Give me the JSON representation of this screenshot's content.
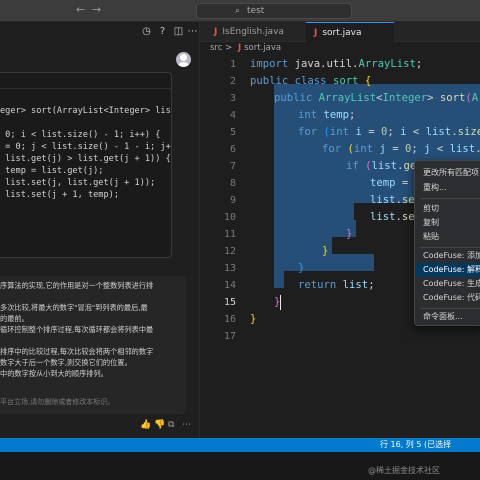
{
  "titlebar": {
    "back_icon": "arrow-left-icon",
    "forward_icon": "arrow-right-icon",
    "search_text": "test"
  },
  "chat": {
    "toolbar_icons": [
      "history-icon",
      "help-icon",
      "split-icon",
      "more-icon"
    ],
    "code_lines": [
      "eger> sort(ArrayList<Integer> list)",
      "",
      " 0; i < list.size() - 1; i++) {",
      " = 0; j < list.size() - 1 - i; j++",
      " list.get(j) > list.get(j + 1)) {",
      " temp = list.get(j);",
      " list.set(j, list.get(j + 1));",
      " list.set(j + 1, temp);"
    ],
    "reply_lines": [
      "序算法的实现,它的作用是对一个整数列表进行排",
      "",
      "多次比较,将最大的数字\"冒泡\"到列表的最后,最",
      "的最前。",
      "循环控制整个排序过程,每次循环都会将列表中最",
      "",
      "排序中的比较过程,每次比较会将两个相邻的数字",
      "数字大于后一个数字,则交换它们的位置。",
      "中的数字按从小到大的顺序排列。"
    ],
    "reply_note": "平台立场,请勿删除或者修改本标识。",
    "actions": [
      "thumb-up-icon",
      "thumb-down-icon",
      "copy-icon",
      "more-icon"
    ]
  },
  "tabs": [
    {
      "label": "IsEnglish.java",
      "icon": "java-file-icon",
      "active": false
    },
    {
      "label": "sort.java",
      "icon": "java-file-icon",
      "active": true
    }
  ],
  "breadcrumb": {
    "folder": "src",
    "sep": ">",
    "file": "sort.java"
  },
  "editor": {
    "current_line": 15,
    "line_numbers": [
      "1",
      "2",
      "3",
      "4",
      "5",
      "6",
      "7",
      "8",
      "9",
      "10",
      "11",
      "12",
      "13",
      "14",
      "15",
      "16",
      "17"
    ]
  },
  "context_menu": {
    "items": [
      {
        "label": "更改所有匹配项",
        "highlighted": false
      },
      {
        "label": "重构...",
        "highlighted": false
      },
      {
        "label": "剪切",
        "highlighted": false
      },
      {
        "label": "复制",
        "highlighted": false
      },
      {
        "label": "粘贴",
        "highlighted": false
      },
      {
        "label": "CodeFuse: 添加",
        "highlighted": false
      },
      {
        "label": "CodeFuse: 解释",
        "highlighted": true
      },
      {
        "label": "CodeFuse: 生成",
        "highlighted": false
      },
      {
        "label": "CodeFuse: 代码",
        "highlighted": false
      },
      {
        "label": "命令面板...",
        "highlighted": false
      }
    ]
  },
  "statusbar": {
    "position": "行 16, 列 5 (已选择",
    "watermark": "@稀土掘金技术社区"
  },
  "colors": {
    "accent": "#007acc",
    "selection": "#264f78",
    "menu_highlight": "#04395e",
    "java_icon": "#f14c4c"
  }
}
